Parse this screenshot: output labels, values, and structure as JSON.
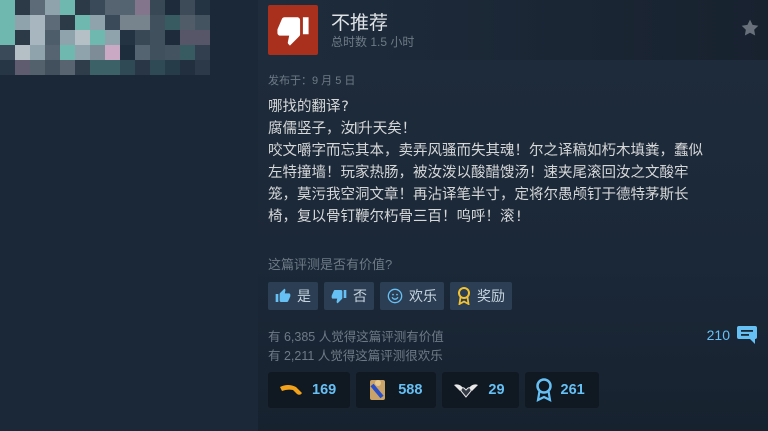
{
  "review": {
    "recommendation": "不推荐",
    "hours": "总时数 1.5 小时",
    "posted": "发布于：9 月 5 日",
    "text": "哪找的翻译?\n腐儒竖子，汝𝄃升天矣！\n咬文嚼字而忘其本，卖弄风骚而失其魂！尔之译稿如朽木填粪，蠢似\n左特撞墙！玩家热肠，被汝泼以酸醋馊汤！速夹尾滚回汝之文酸牢\n笼，莫污我空洞文章！再沾译笔半寸，定将尔愚颅钉于德特茅斯长\n椅，复以骨钉鞭尔朽骨三百！呜呼！滚!"
  },
  "helpful": {
    "question": "这篇评测是否有价值?",
    "yes_label": "是",
    "no_label": "否",
    "funny_label": "欢乐",
    "award_label": "奖励"
  },
  "stats": {
    "helpful_line": "有 6,385 人觉得这篇评测有价值",
    "funny_line": "有 2,211 人觉得这篇评测很欢乐",
    "comments": "210"
  },
  "awards": [
    {
      "icon": "boomerang-icon",
      "count": "169",
      "color": "#f2a21a"
    },
    {
      "icon": "scroll-icon",
      "count": "588",
      "color": "#c9a36a"
    },
    {
      "icon": "winged-heart-icon",
      "count": "29",
      "color": "#e8e8e8"
    },
    {
      "icon": "award-medal-icon",
      "count": "261",
      "color": "#66c0f4"
    }
  ],
  "colors": {
    "thumb_down_bg": "#a8301c",
    "link_blue": "#66c0f4",
    "background": "#1b2838"
  }
}
